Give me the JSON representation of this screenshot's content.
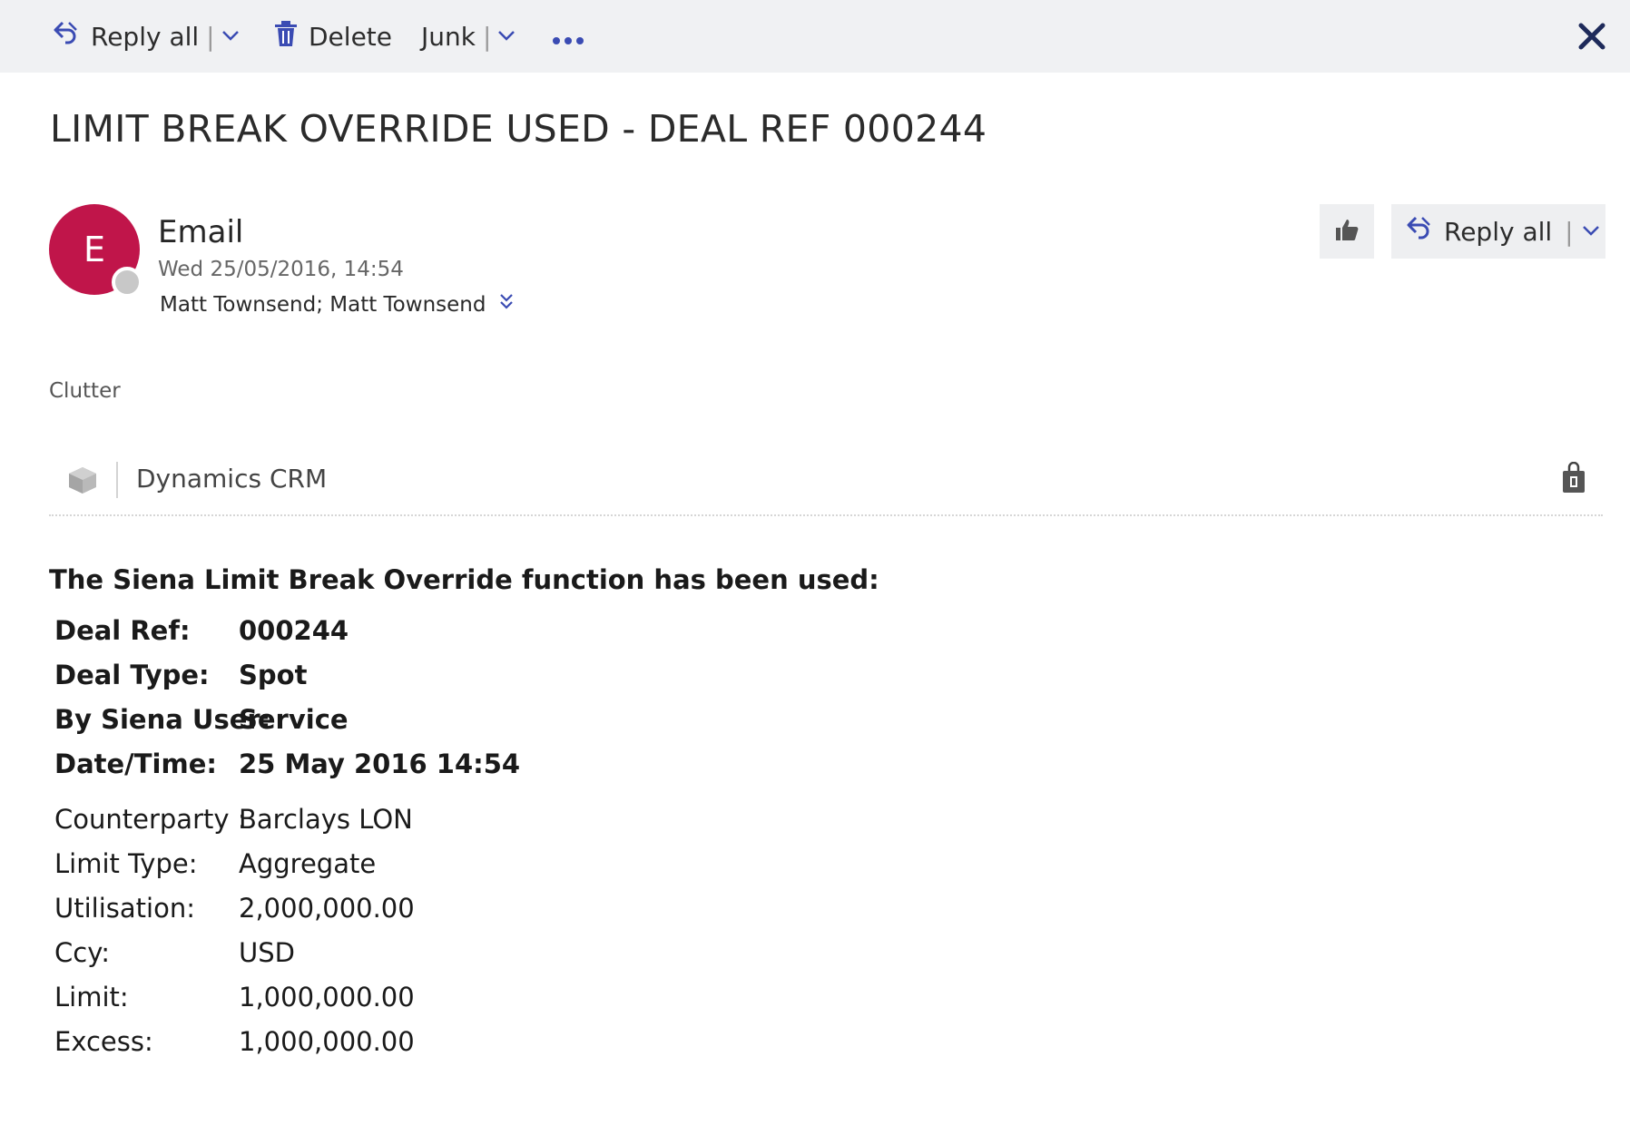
{
  "colors": {
    "accent": "#3a4bb3",
    "avatar_bg": "#c0154a",
    "toolbar_bg": "#f0f1f3"
  },
  "toolbar": {
    "reply_all": {
      "label": "Reply all",
      "icon": "reply-all-icon"
    },
    "delete": {
      "label": "Delete",
      "icon": "trash-icon"
    },
    "junk": {
      "label": "Junk"
    },
    "more_icon": "more-icon",
    "close_icon": "close-icon"
  },
  "message": {
    "subject": "LIMIT BREAK OVERRIDE USED - DEAL REF 000244",
    "avatar_initial": "E",
    "sender": "Email",
    "date": "Wed 25/05/2016, 14:54",
    "recipients": "Matt Townsend; Matt Townsend",
    "category": "Clutter",
    "reply_all_label": "Reply all"
  },
  "addin": {
    "name": "Dynamics CRM"
  },
  "body": {
    "intro": "The Siena Limit Break Override function has been used:",
    "fields": [
      {
        "key": "Deal Ref:",
        "value": "000244",
        "bold": true
      },
      {
        "key": "Deal Type:",
        "value": "Spot",
        "bold": true
      },
      {
        "key": "By Siena User:",
        "value": "Service",
        "bold": true
      },
      {
        "key": "Date/Time:",
        "value": "25 May 2016 14:54",
        "bold": true
      },
      {
        "key": "Counterparty :",
        "value": "Barclays LON",
        "bold": false
      },
      {
        "key": "Limit Type:",
        "value": "Aggregate",
        "bold": false
      },
      {
        "key": "Utilisation:",
        "value": "2,000,000.00",
        "bold": false
      },
      {
        "key": "Ccy:",
        "value": "USD",
        "bold": false
      },
      {
        "key": "Limit:",
        "value": "1,000,000.00",
        "bold": false
      },
      {
        "key": "Excess:",
        "value": "1,000,000.00",
        "bold": false
      }
    ]
  }
}
